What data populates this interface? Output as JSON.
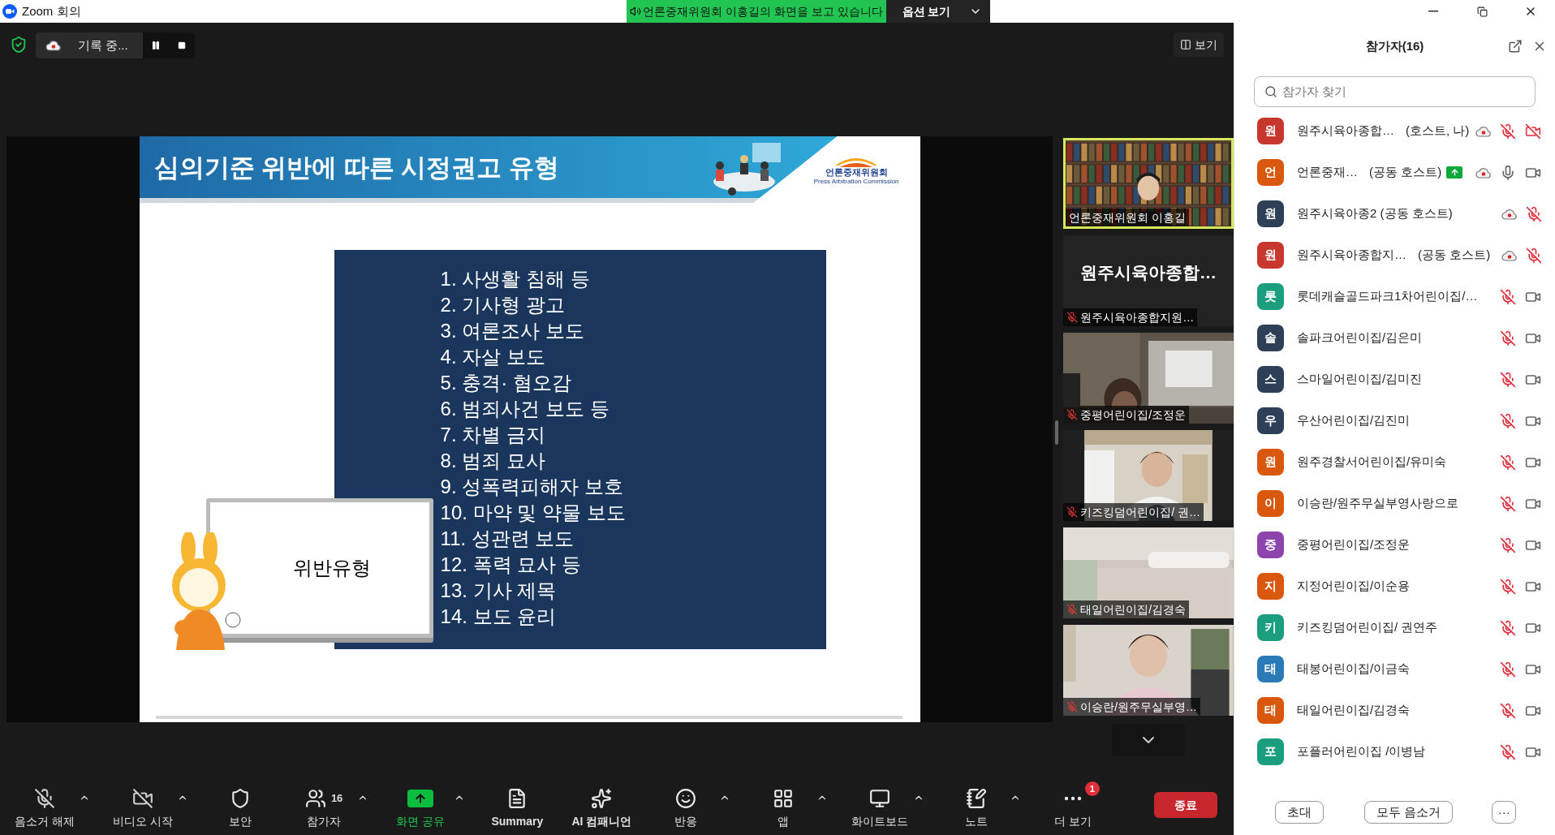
{
  "window": {
    "title": "Zoom 회의"
  },
  "share_banner": {
    "text": "언론중재위원회 이홍길의 화면을 보고 있습니다",
    "button": "옵션 보기"
  },
  "recording": {
    "label": "기록 중..."
  },
  "view_button": "보기",
  "slide": {
    "title": "심의기준 위반에 따른 시정권고 유형",
    "logo_text": "언론중재위원회",
    "logo_subtitle": "Press Arbitration Commission",
    "board_text": "위반유형",
    "items": [
      "1. 사생활 침해 등",
      "2. 기사형 광고",
      "3. 여론조사 보도",
      "4. 자살 보도",
      "5. 충격· 혐오감",
      "6. 범죄사건 보도 등",
      "7. 차별 금지",
      "8. 범죄 묘사",
      "9. 성폭력피해자 보호",
      "10. 마약 및 약물 보도",
      "11. 성관련 보도",
      "12. 폭력 묘사 등",
      "13. 기사 제목",
      "14. 보도 윤리"
    ]
  },
  "video_tiles": [
    {
      "kind": "video",
      "name": "언론중재위원회 이홍길",
      "speaking": true,
      "muted": false
    },
    {
      "kind": "name_only",
      "display_name": "원주시육아종합…",
      "name": "원주시육아종합지원…",
      "speaking": false,
      "muted": true
    },
    {
      "kind": "video",
      "name": "중평어린이집/조정운",
      "speaking": false,
      "muted": true
    },
    {
      "kind": "video",
      "name": "키즈킹덤어린이집/ 권…",
      "speaking": false,
      "muted": true
    },
    {
      "kind": "video",
      "name": "태일어린이집/김경숙",
      "speaking": false,
      "muted": true
    },
    {
      "kind": "video",
      "name": "이승란/원주무실부영…",
      "speaking": false,
      "muted": true
    }
  ],
  "toolbar": [
    {
      "kind": "mic_off",
      "label": "음소거 해제",
      "caret": true,
      "active": false
    },
    {
      "kind": "video_off",
      "label": "비디오 시작",
      "caret": true,
      "active": false
    },
    {
      "kind": "security",
      "label": "보안",
      "caret": false,
      "active": false
    },
    {
      "kind": "participants",
      "label": "참가자",
      "count": "16",
      "caret": true,
      "active": false
    },
    {
      "kind": "share",
      "label": "화면 공유",
      "caret": true,
      "active": true
    },
    {
      "kind": "summary",
      "label": "Summary",
      "caret": false,
      "active": false
    },
    {
      "kind": "ai",
      "label": "AI 컴패니언",
      "caret": false,
      "active": false
    },
    {
      "kind": "reactions",
      "label": "반응",
      "caret": true,
      "active": false
    },
    {
      "kind": "apps",
      "label": "앱",
      "caret": true,
      "active": false
    },
    {
      "kind": "whiteboard",
      "label": "화이트보드",
      "caret": true,
      "active": false
    },
    {
      "kind": "notes",
      "label": "노트",
      "caret": true,
      "active": false
    },
    {
      "kind": "more",
      "label": "더 보기",
      "badge": "1",
      "caret": false,
      "active": false
    }
  ],
  "end_button": "종료",
  "participants_panel": {
    "title": "참가자(16)",
    "search_placeholder": "참가자 찾기",
    "participants": [
      {
        "initial": "원",
        "color": "#c8372d",
        "name": "원주시육아종합…",
        "role": "(호스트, 나)",
        "sharing": false,
        "recording": true,
        "muted": true,
        "camera_on": false
      },
      {
        "initial": "언",
        "color": "#d9580d",
        "name": "언론중재…",
        "role": "(공동 호스트)",
        "sharing": true,
        "recording": true,
        "muted": false,
        "camera_on": true
      },
      {
        "initial": "원",
        "color": "#2e4057",
        "name": "원주시육아종2 (공동 호스트)",
        "sharing": false,
        "recording": true,
        "muted": true
      },
      {
        "initial": "원",
        "color": "#c8372d",
        "name": "원주시육아종합지…",
        "role": "(공동 호스트)",
        "sharing": false,
        "recording": true,
        "muted": true
      },
      {
        "initial": "롯",
        "color": "#1a9e7e",
        "name": "롯데캐슬골드파크1차어린이집/…",
        "sharing": false,
        "recording": false,
        "muted": true,
        "camera_on": true
      },
      {
        "initial": "솔",
        "color": "#2e4057",
        "name": "솔파크어린이집/김은미",
        "sharing": false,
        "recording": false,
        "muted": true,
        "camera_on": true
      },
      {
        "initial": "스",
        "color": "#2e4057",
        "name": "스마일어린이집/김미진",
        "sharing": false,
        "recording": false,
        "muted": true,
        "camera_on": true
      },
      {
        "initial": "우",
        "color": "#2e4057",
        "name": "우산어린이집/김진미",
        "sharing": false,
        "recording": false,
        "muted": true,
        "camera_on": true
      },
      {
        "initial": "원",
        "color": "#d9580d",
        "name": "원주경찰서어린이집/유미숙",
        "sharing": false,
        "recording": false,
        "muted": true,
        "camera_on": true
      },
      {
        "initial": "이",
        "color": "#d9580d",
        "name": "이승란/원주무실부영사랑으로",
        "sharing": false,
        "recording": false,
        "muted": true,
        "camera_on": true
      },
      {
        "initial": "중",
        "color": "#8e44ad",
        "name": "중평어린이집/조정운",
        "sharing": false,
        "recording": false,
        "muted": true,
        "camera_on": true
      },
      {
        "initial": "지",
        "color": "#d9580d",
        "name": "지정어린이집/이순용",
        "sharing": false,
        "recording": false,
        "muted": true,
        "camera_on": true
      },
      {
        "initial": "키",
        "color": "#1a9e7e",
        "name": "키즈킹덤어린이집/ 권연주",
        "sharing": false,
        "recording": false,
        "muted": true,
        "camera_on": true
      },
      {
        "initial": "태",
        "color": "#2a7ab8",
        "name": "태봉어린이집/이금숙",
        "sharing": false,
        "recording": false,
        "muted": true,
        "camera_on": true
      },
      {
        "initial": "태",
        "color": "#d9580d",
        "name": "태일어린이집/김경숙",
        "sharing": false,
        "recording": false,
        "muted": true,
        "camera_on": true
      },
      {
        "initial": "포",
        "color": "#1a9e7e",
        "name": "포플러어린이집 /이병남",
        "sharing": false,
        "recording": false,
        "muted": true,
        "camera_on": true
      }
    ],
    "buttons": [
      "초대",
      "모두 음소거",
      "···"
    ]
  }
}
